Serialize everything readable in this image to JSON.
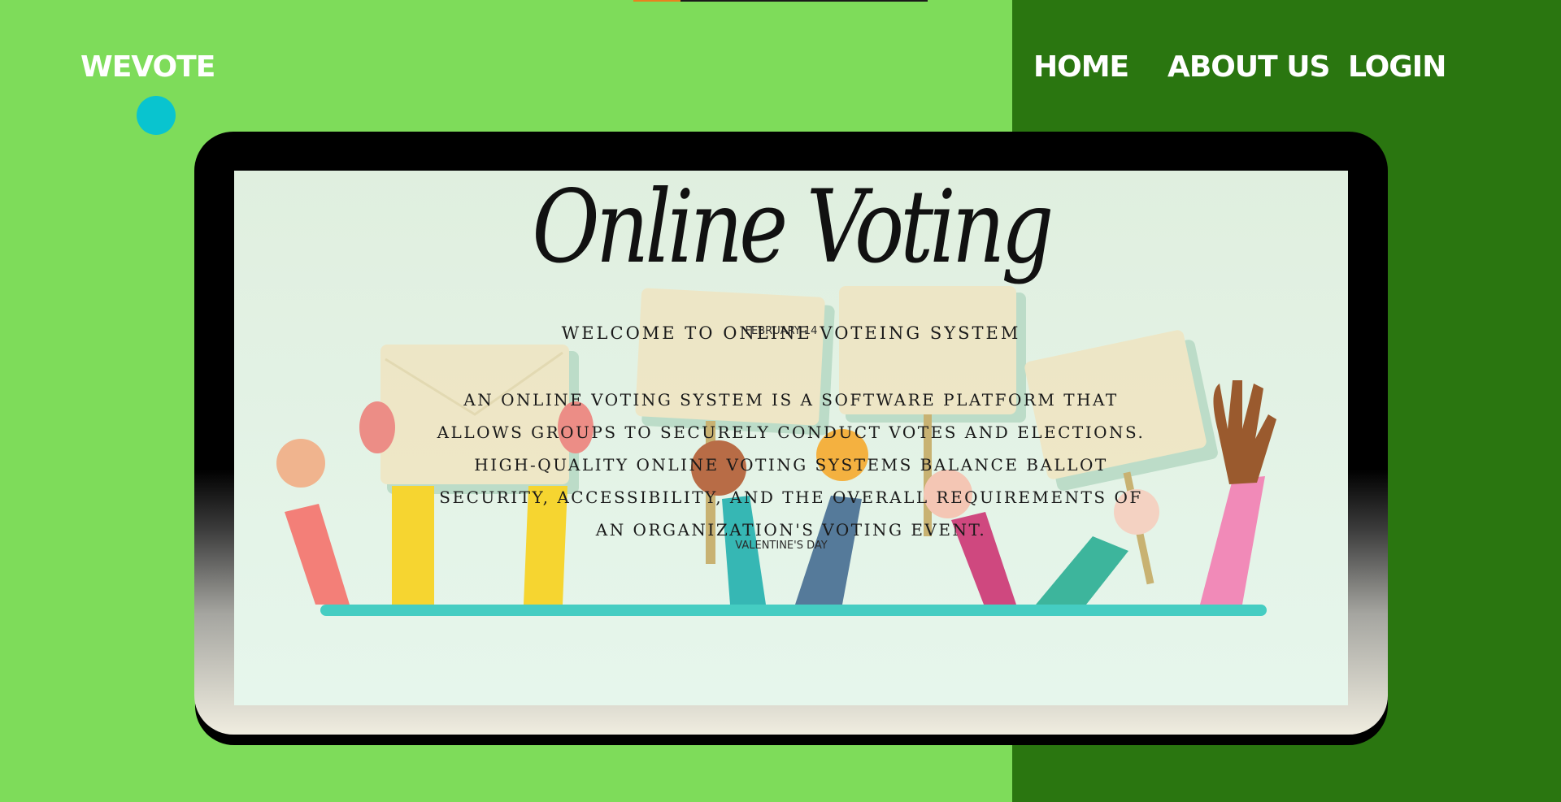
{
  "header": {
    "logo": "WEVOTE",
    "nav": {
      "home": "HOME",
      "about": "ABOUT US",
      "login": "LOGIN"
    }
  },
  "hero": {
    "title": "Online Voting",
    "welcome": "WELCOME TO ONLINE VOTEING SYSTEM",
    "description": "AN ONLINE VOTING SYSTEM IS A SOFTWARE PLATFORM THAT ALLOWS GROUPS TO SECURELY CONDUCT VOTES AND ELECTIONS. HIGH-QUALITY ONLINE VOTING SYSTEMS BALANCE BALLOT SECURITY, ACCESSIBILITY, AND THE OVERALL REQUIREMENTS OF AN ORGANIZATION'S VOTING EVENT.",
    "background_label_top": "FEBRUARY 14",
    "background_label_bottom": "VALENTINE'S DAY"
  },
  "progress": {
    "fraction": 0.16
  },
  "colors": {
    "page_bg": "#7edc5a",
    "right_panel": "#2a7610",
    "logo_dot": "#09c4cf",
    "accent_bar": "#e8821e"
  },
  "icons": [
    "logo-dot",
    "raised-hands-illustration"
  ]
}
